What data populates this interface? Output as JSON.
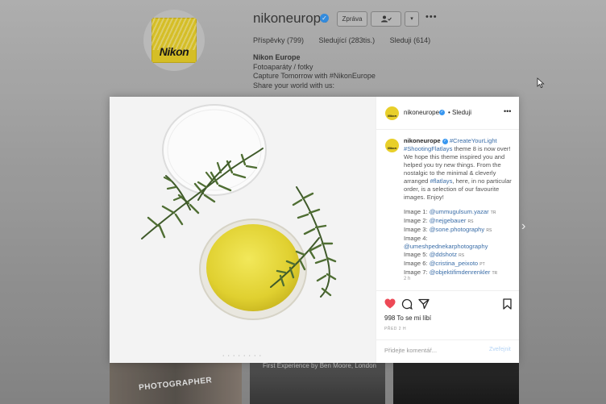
{
  "profile": {
    "username": "nikoneurope",
    "message_label": "Zpráva",
    "follow_icon": "person-check-icon",
    "dropdown_icon": "chevron-down-icon",
    "more_label": "•••",
    "logo_text": "Nikon",
    "stats": {
      "posts": "Příspěvky (799)",
      "followers": "Sledující (283tis.)",
      "following": "Sleduji (614)"
    },
    "bio": {
      "name": "Nikon Europe",
      "line1": "Fotoaparáty / fotky",
      "line2": "Capture Tomorrow with #NikonEurope",
      "line3": "Share your world with us:"
    }
  },
  "modal": {
    "header": {
      "username": "nikoneurope",
      "separator": "•",
      "follow_label": "Sleduji",
      "more_label": "•••"
    },
    "caption": {
      "username": "nikoneurope",
      "tag1": "#CreateYourLight",
      "tag2": "#ShootingFlatlays",
      "text1": "theme 8 is now over! We hope this theme inspired you and helped you try new things. From the nostalgic to the minimal & cleverly arranged",
      "tag3": "#flatlays",
      "text2": ", here, in no particular order, is a selection of our favourite images. Enjoy!",
      "images": [
        {
          "label": "Image 1:",
          "handle": "@ummugulsum.yazar",
          "cc": "TR"
        },
        {
          "label": "Image 2:",
          "handle": "@nejgebauer",
          "cc": "RS"
        },
        {
          "label": "Image 3:",
          "handle": "@sone.photography",
          "cc": "RS"
        },
        {
          "label": "Image 4:",
          "handle": "",
          "cc": ""
        },
        {
          "label": "",
          "handle": "@umeshpednekarphotography",
          "cc": ""
        },
        {
          "label": "Image 5:",
          "handle": "@ddshotz",
          "cc": "RS"
        },
        {
          "label": "Image 6:",
          "handle": "@cristina_peixoto",
          "cc": "PT"
        },
        {
          "label": "Image 7:",
          "handle": "@objektifimdenrenkler",
          "cc": "TR"
        }
      ],
      "time": "2 h"
    },
    "likes": "998 To se mi líbí",
    "date": "PŘED 2 H",
    "comment_placeholder": "Přidejte komentář...",
    "post_label": "Zveřejnit",
    "carousel_dots": "• • • • • • • •"
  },
  "background": {
    "thumb_caption": "First Experience by Ben Moore, London",
    "thumb_word": "PHOTOGRAPHER"
  },
  "colors": {
    "accent": "#3897f0",
    "heart": "#ed4956",
    "nikon_yellow": "#e8cf2a",
    "oil": "#e3d63a"
  }
}
